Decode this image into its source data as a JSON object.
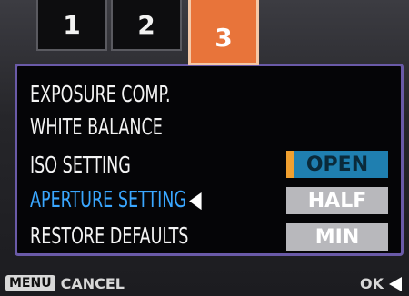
{
  "tabs": [
    {
      "label": "1"
    },
    {
      "label": "2"
    },
    {
      "label": "3"
    }
  ],
  "menu": {
    "items": [
      {
        "label": "EXPOSURE COMP."
      },
      {
        "label": "WHITE BALANCE"
      },
      {
        "label": "ISO SETTING"
      },
      {
        "label": "APERTURE SETTING"
      },
      {
        "label": "RESTORE DEFAULTS"
      }
    ],
    "selected_arrow": "◀",
    "options": [
      {
        "label": "OPEN"
      },
      {
        "label": "HALF"
      },
      {
        "label": "MIN"
      }
    ]
  },
  "footer": {
    "menu_badge": "MENU",
    "cancel_label": "CANCEL",
    "ok_label": "OK"
  },
  "colors": {
    "tab_active": "#e8743a",
    "panel_border": "#6a5aa8",
    "selected_text": "#3aa7ff",
    "option_highlight": "#1f7fb0",
    "option_marker": "#f0a030"
  }
}
